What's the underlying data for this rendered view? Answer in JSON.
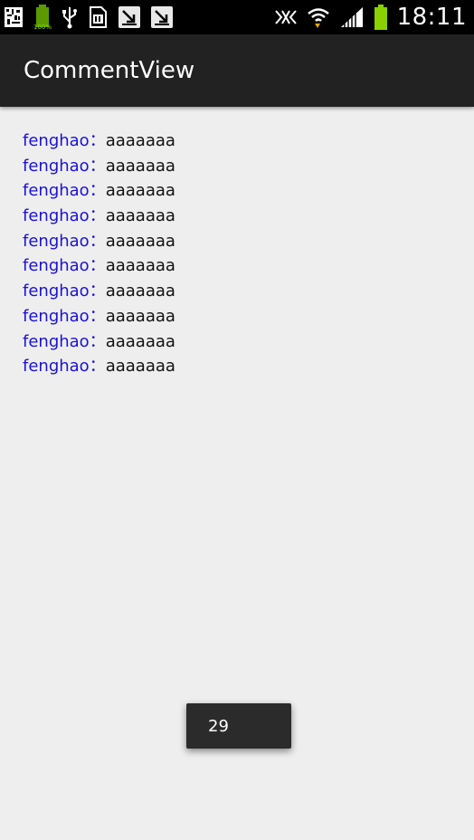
{
  "status_bar": {
    "time": "18:11",
    "battery_small_label": "100%",
    "left_icons": [
      "qr-code-icon",
      "battery-full-icon",
      "usb-icon",
      "sd-card-icon",
      "download-icon",
      "download-icon"
    ],
    "right_icons": [
      "nfc-icon",
      "wifi-icon",
      "signal-icon",
      "battery-icon"
    ],
    "accent_color": "#8bd000"
  },
  "app_bar": {
    "title": "CommentView"
  },
  "comments": [
    {
      "author": "fenghao",
      "separator": "：",
      "text": "aaaaaaa"
    },
    {
      "author": "fenghao",
      "separator": "：",
      "text": "aaaaaaa"
    },
    {
      "author": "fenghao",
      "separator": "：",
      "text": "aaaaaaa"
    },
    {
      "author": "fenghao",
      "separator": "：",
      "text": "aaaaaaa"
    },
    {
      "author": "fenghao",
      "separator": "：",
      "text": "aaaaaaa"
    },
    {
      "author": "fenghao",
      "separator": "：",
      "text": "aaaaaaa"
    },
    {
      "author": "fenghao",
      "separator": "：",
      "text": "aaaaaaa"
    },
    {
      "author": "fenghao",
      "separator": "：",
      "text": "aaaaaaa"
    },
    {
      "author": "fenghao",
      "separator": "：",
      "text": "aaaaaaa"
    },
    {
      "author": "fenghao",
      "separator": "：",
      "text": "aaaaaaa"
    }
  ],
  "colors": {
    "author": "#1a12d8",
    "comment_text": "#111111",
    "background": "#eeeeee",
    "app_bar": "#222222"
  },
  "toast": {
    "text": "29"
  }
}
